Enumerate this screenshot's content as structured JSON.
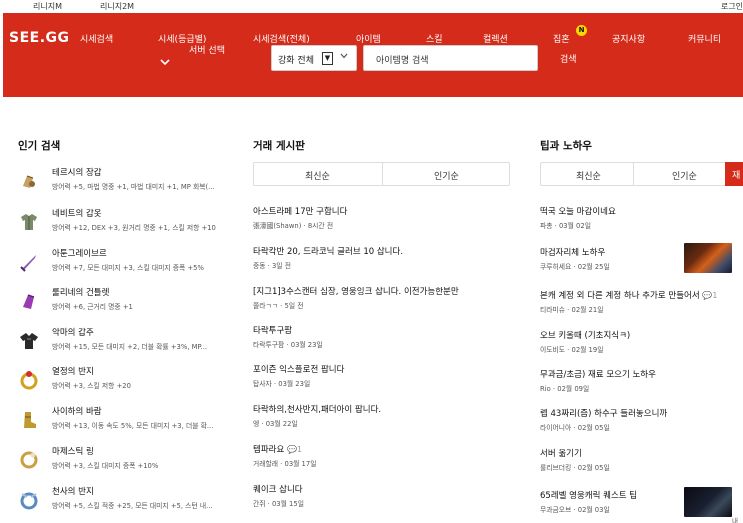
{
  "topbar": {
    "links": [
      "리니지M",
      "리니지2M"
    ],
    "login": "로그인"
  },
  "nav": {
    "logo": "SEE.GG",
    "items": [
      "시세검색",
      "시세(등급별)",
      "서버 선택",
      "시세검색(전체)",
      "아이템",
      "스킬",
      "컬렉션",
      "집혼",
      "검색",
      "공지사항",
      "커뮤니티"
    ],
    "badge": "N"
  },
  "filter": {
    "selected": "강화 전체",
    "search_placeholder": "아이템명 검색"
  },
  "popular": {
    "title": "인기 검색",
    "items": [
      {
        "name": "테르시의 장갑",
        "desc": "방어력 +5, 마법 명중 +1, 마법 대미지 +1, MP 회복(...",
        "icon": "glove-icon"
      },
      {
        "name": "네비트의 갑옷",
        "desc": "방어력 +12, DEX +3, 원거리 명중 +1, 스킬 저항 +10",
        "icon": "armor-icon"
      },
      {
        "name": "아툰그레이브르",
        "desc": "방어력 +7, 모든 대미지 +3, 스킬 대미지 증폭 +5%",
        "icon": "sword-icon"
      },
      {
        "name": "룰리네의 건틀렛",
        "desc": "방어력 +6, 근거리 명중 +1",
        "icon": "gauntlet-icon"
      },
      {
        "name": "악마의 갑주",
        "desc": "방어력 +15, 모든 대미지 +2, 더블 확률 +3%, MP...",
        "icon": "demon-armor-icon"
      },
      {
        "name": "열정의 반지",
        "desc": "방어력 +3, 스킬 저항 +20",
        "icon": "ring-icon"
      },
      {
        "name": "사이하의 바람",
        "desc": "방어력 +13, 이동 속도 5%, 모든 대미지 +3, 더블 확...",
        "icon": "boots-icon"
      },
      {
        "name": "마제스틱 링",
        "desc": "방어력 +3, 스킬 대미지 증폭 +10%",
        "icon": "ring-icon"
      },
      {
        "name": "천사의 반지",
        "desc": "방어력 +5, 스킬 적중 +25, 모든 대미지 +5, 스턴 내...",
        "icon": "angel-ring-icon"
      }
    ]
  },
  "trade": {
    "title": "거래 게시판",
    "tabs": [
      "최신순",
      "인기순"
    ],
    "posts": [
      {
        "title": "아스트라페 17만 구합니다",
        "meta": "張濠國(Shawn) · 8시간 전"
      },
      {
        "title": "타락칵반 20, 드라코닉 글러브 10 삽니다.",
        "meta": "중동 · 3일 전"
      },
      {
        "title": "[지그1]3수스캔터 심장, 영웅잉크 삽니다. 이전가능한분만",
        "meta": "쫄라ㄱㄱ · 5일 전"
      },
      {
        "title": "타락투구팜",
        "meta": "타락투구팜 · 03월 23일"
      },
      {
        "title": "포이즌 익스플로전 팝니다",
        "meta": "탑사자 · 03월 23일"
      },
      {
        "title": "타락하의,천사반지,패더아이 팝니다.",
        "meta": "엥 · 03월 22일"
      },
      {
        "title": "템파라요",
        "meta": "거래할래 · 03월 17일",
        "comments": "1"
      },
      {
        "title": "퀘이크 삽니다",
        "meta": "간쥐 · 03월 15일"
      }
    ]
  },
  "tips": {
    "title": "팁과 노하우",
    "tabs": [
      "최신순",
      "인기순",
      "재"
    ],
    "posts": [
      {
        "title": "떡국 오늘 마감이네요",
        "meta": "파총 · 03월 02일"
      },
      {
        "title": "마검자리체 노하우",
        "meta": "쿠루히세요 · 02월 25일",
        "thumb": "fire"
      },
      {
        "title": "본캐 계정 외 다른 계정 하나 추가로 만들어서",
        "meta": "티라미슈 · 02월 21일",
        "comments": "1"
      },
      {
        "title": "오브 키올때 (기초지식ㅋ)",
        "meta": "이도비도 · 02월 19일"
      },
      {
        "title": "무과금/초금) 재료 모으기 노하우",
        "meta": "Rio · 02월 09일"
      },
      {
        "title": "렙 43짜리(즘) 하수구 들러놓으니까",
        "meta": "라이어니아 · 02월 05일"
      },
      {
        "title": "서버 옮기기",
        "meta": "룰리브더킹 · 02월 05일"
      },
      {
        "title": "65레벨 영웅캐릭 퀘스트 팁",
        "meta": "무과금오브 · 02월 03일",
        "thumb": "dark"
      }
    ],
    "corner": "내부"
  },
  "colors": {
    "brand": "#d42b1a",
    "badge": "#ffd700"
  }
}
